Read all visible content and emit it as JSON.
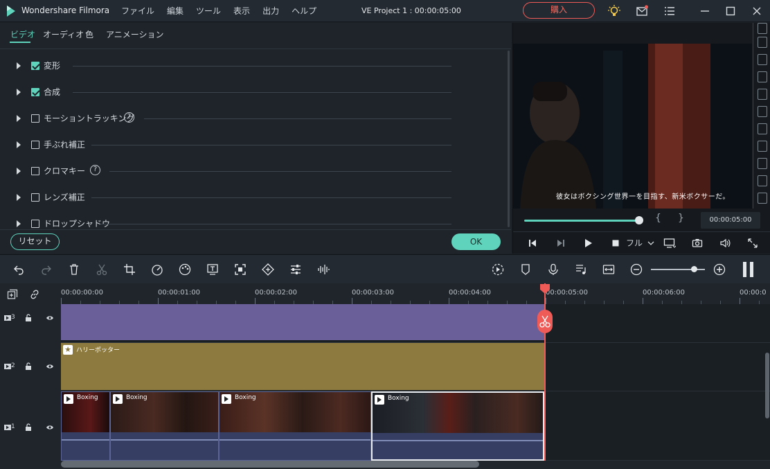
{
  "app": {
    "name": "Wondershare Filmora",
    "menu": [
      "ファイル",
      "編集",
      "ツール",
      "表示",
      "出力",
      "ヘルプ"
    ],
    "project_title": "VE Project 1 : 00:00:05:00",
    "buy_label": "購入"
  },
  "props": {
    "tabs": [
      "ビデオ",
      "オーディオ",
      "色",
      "アニメーション"
    ],
    "sections": [
      {
        "label": "変形",
        "checked": true
      },
      {
        "label": "合成",
        "checked": true
      },
      {
        "label": "モーショントラッキング",
        "checked": false,
        "help": "?"
      },
      {
        "label": "手ぶれ補正",
        "checked": false
      },
      {
        "label": "クロマキー",
        "checked": false,
        "help": "?"
      },
      {
        "label": "レンズ補正",
        "checked": false
      },
      {
        "label": "ドロップシャドウ",
        "checked": false
      }
    ],
    "reset_label": "リセット",
    "ok_label": "OK"
  },
  "preview": {
    "subtitle": "彼女はボクシング世界一を目指す、新米ボクサーだ。",
    "timecode": "00:00:05:00",
    "brace_open": "{",
    "brace_close": "}",
    "quality_label": "フル",
    "progress": 1.0
  },
  "timeline": {
    "ruler_labels": [
      "00:00:00:00",
      "00:00:01:00",
      "00:00:02:00",
      "00:00:03:00",
      "00:00:04:00",
      "00:00:05:00",
      "00:00:06:00",
      "00:00:0"
    ],
    "tracks": [
      {
        "num": "3"
      },
      {
        "num": "2"
      },
      {
        "num": "1"
      }
    ],
    "title_clip": "ハリーポッター",
    "video_clips": [
      "Boxing",
      "Boxing",
      "Boxing",
      "Boxing"
    ]
  },
  "colors": {
    "accent": "#5fd3bc",
    "playhead": "#ef5b57",
    "purple_clip": "#6b5f9a",
    "gold_clip": "#8c7a3e",
    "video_clip": "#363f63"
  }
}
